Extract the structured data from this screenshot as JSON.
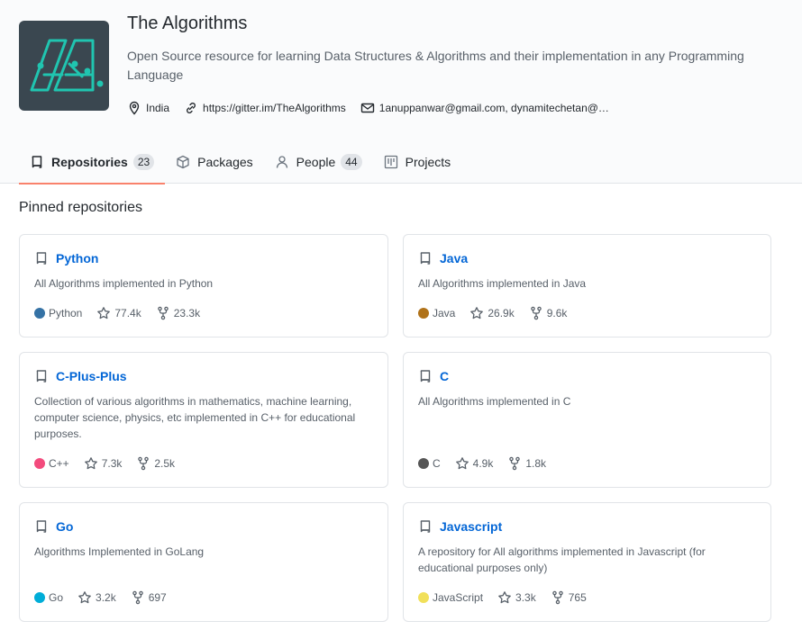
{
  "org": {
    "name": "The Algorithms",
    "description": "Open Source resource for learning Data Structures & Algorithms and their implementation in any Programming Language",
    "location": "India",
    "website": "https://gitter.im/TheAlgorithms",
    "email": "1anuppanwar@gmail.com, dynamitechetan@…"
  },
  "tabs": [
    {
      "label": "Repositories",
      "count": "23",
      "icon": "repo-icon",
      "selected": true
    },
    {
      "label": "Packages",
      "icon": "package-icon"
    },
    {
      "label": "People",
      "count": "44",
      "icon": "person-icon"
    },
    {
      "label": "Projects",
      "icon": "project-icon"
    }
  ],
  "pinned": {
    "title": "Pinned repositories",
    "repos": [
      {
        "name": "Python",
        "description": "All Algorithms implemented in Python",
        "language": "Python",
        "language_color": "#3572A5",
        "stars": "77.4k",
        "forks": "23.3k"
      },
      {
        "name": "Java",
        "description": "All Algorithms implemented in Java",
        "language": "Java",
        "language_color": "#b07219",
        "stars": "26.9k",
        "forks": "9.6k"
      },
      {
        "name": "C-Plus-Plus",
        "description": "Collection of various algorithms in mathematics, machine learning, computer science, physics, etc implemented in C++ for educational purposes.",
        "language": "C++",
        "language_color": "#f34b7d",
        "stars": "7.3k",
        "forks": "2.5k"
      },
      {
        "name": "C",
        "description": "All Algorithms implemented in C",
        "language": "C",
        "language_color": "#555555",
        "stars": "4.9k",
        "forks": "1.8k"
      },
      {
        "name": "Go",
        "description": "Algorithms Implemented in GoLang",
        "language": "Go",
        "language_color": "#00ADD8",
        "stars": "3.2k",
        "forks": "697"
      },
      {
        "name": "Javascript",
        "description": "A repository for All algorithms implemented in Javascript (for educational purposes only)",
        "language": "JavaScript",
        "language_color": "#f1e05a",
        "stars": "3.3k",
        "forks": "765"
      }
    ]
  }
}
